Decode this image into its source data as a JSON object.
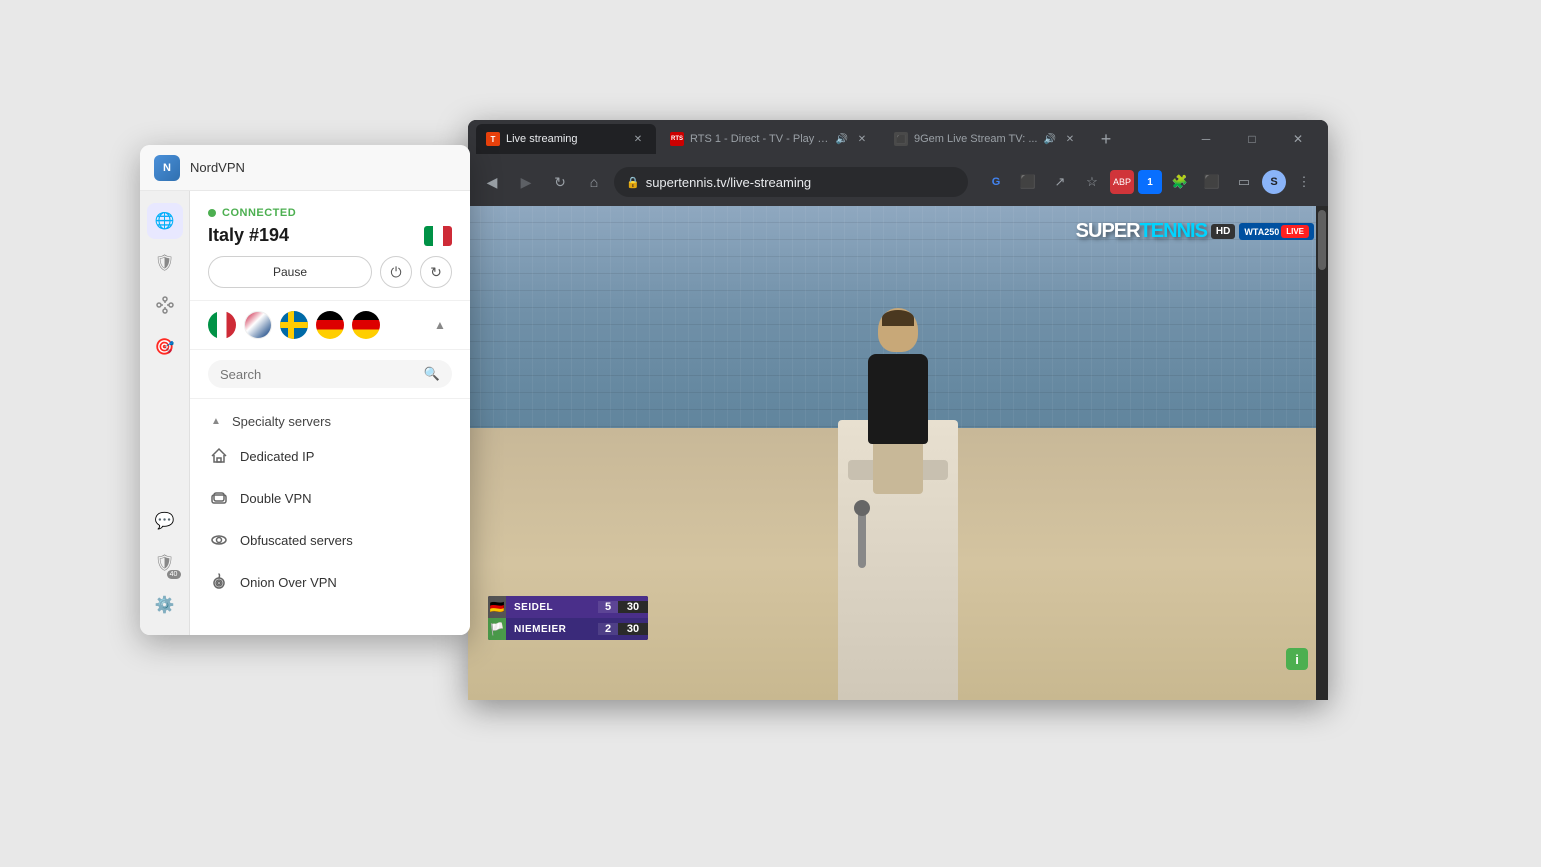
{
  "browser": {
    "tabs": [
      {
        "id": "tab-1",
        "label": "Live streaming",
        "favicon_text": "T",
        "active": true,
        "favicon_color": "#e8410c"
      },
      {
        "id": "tab-2",
        "label": "RTS 1 - Direct - TV - Play R...",
        "favicon_text": "RTS",
        "active": false,
        "favicon_color": "#cc0000",
        "has_audio": true
      },
      {
        "id": "tab-3",
        "label": "9Gem Live Stream TV: ...",
        "favicon_text": "⬛",
        "active": false,
        "favicon_color": "#4a4a4a"
      }
    ],
    "new_tab_label": "+",
    "window_controls": [
      "minimize",
      "maximize",
      "close"
    ],
    "url": "supertennis.tv/live-streaming",
    "nav_buttons": [
      "back",
      "forward",
      "reload",
      "home"
    ]
  },
  "video": {
    "logo_text": "SUPER",
    "logo_tennis": "TENNIS",
    "logo_hd": "HD",
    "wta_label": "WTA250",
    "live_label": "LIVE",
    "score": {
      "player1_name": "SEIDEL",
      "player1_set": "5",
      "player1_game": "30",
      "player2_name": "NIEMEIER",
      "player2_set": "2",
      "player2_game": "30"
    }
  },
  "nordvpn": {
    "app_name": "NordVPN",
    "connected_label": "CONNECTED",
    "server_name": "Italy #194",
    "pause_label": "Pause",
    "sidebar_icons": [
      "globe",
      "shield",
      "mesh",
      "target",
      "chat",
      "settings"
    ],
    "badge_count": "40",
    "search_placeholder": "Search",
    "specialty_servers_label": "Specialty servers",
    "menu_items": [
      {
        "id": "dedicated-ip",
        "label": "Dedicated IP",
        "icon": "house"
      },
      {
        "id": "double-vpn",
        "label": "Double VPN",
        "icon": "layers"
      },
      {
        "id": "obfuscated",
        "label": "Obfuscated servers",
        "icon": "eye"
      },
      {
        "id": "onion",
        "label": "Onion Over VPN",
        "icon": "onion"
      }
    ],
    "flag_row": [
      "italy",
      "korea",
      "sweden",
      "germany",
      "germany2"
    ]
  }
}
